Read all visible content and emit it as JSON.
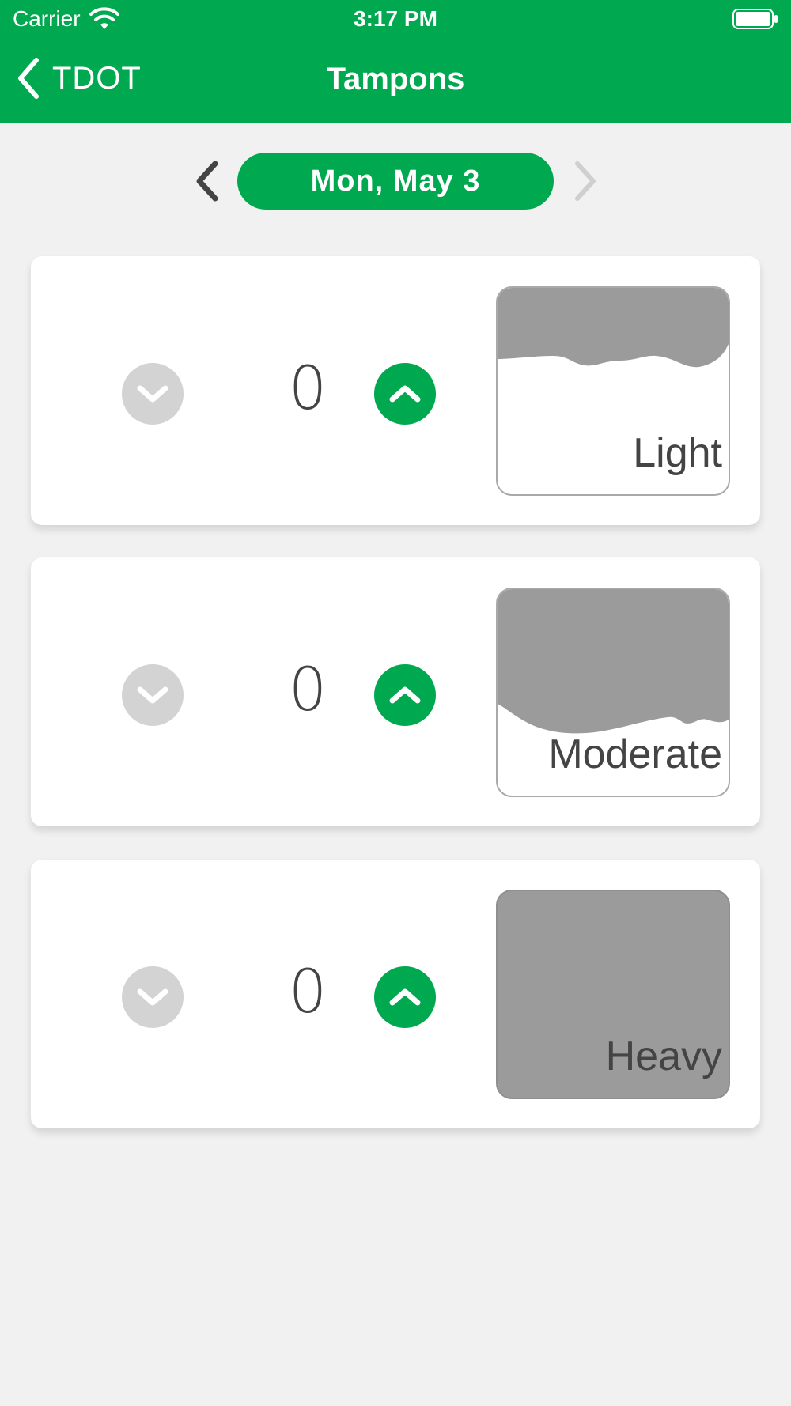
{
  "status_bar": {
    "carrier": "Carrier",
    "time": "3:17 PM"
  },
  "nav": {
    "back_label": "TDOT",
    "title": "Tampons"
  },
  "date_selector": {
    "date": "Mon, May 3"
  },
  "flow_items": [
    {
      "label": "Light",
      "count": "0"
    },
    {
      "label": "Moderate",
      "count": "0"
    },
    {
      "label": "Heavy",
      "count": "0"
    }
  ],
  "colors": {
    "accent": "#00a84f",
    "disabled": "#d3d3d3",
    "swatch_fill": "#9b9b9b"
  }
}
